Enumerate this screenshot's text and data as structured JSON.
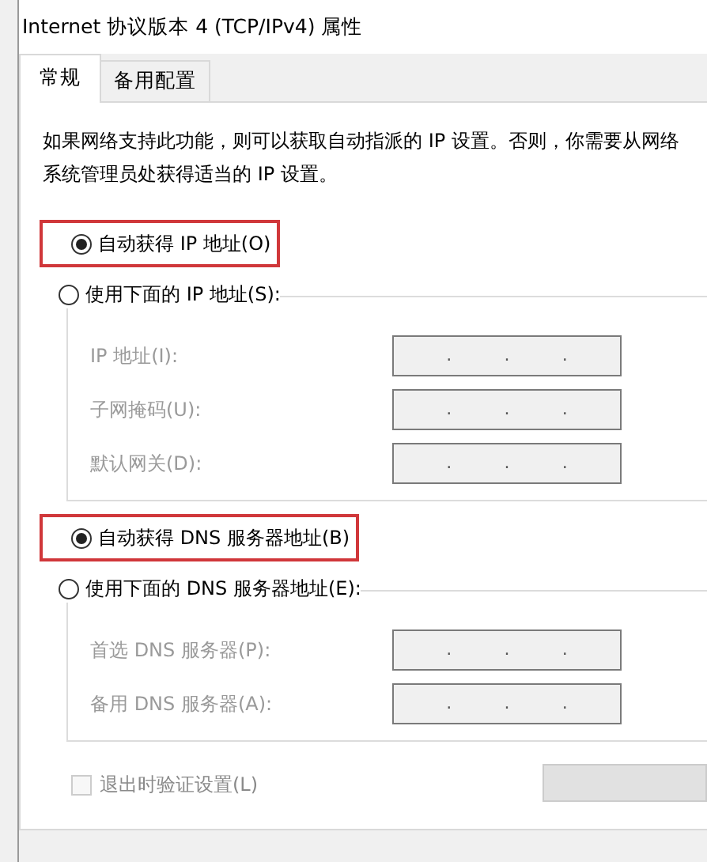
{
  "window": {
    "title": "Internet 协议版本 4 (TCP/IPv4) 属性"
  },
  "tabs": [
    {
      "label": "常规",
      "selected": true
    },
    {
      "label": "备用配置",
      "selected": false
    }
  ],
  "description": "如果网络支持此功能，则可以获取自动指派的 IP 设置。否则，你需要从网络系统管理员处获得适当的 IP 设置。",
  "sections": [
    {
      "auto_option": {
        "label": "自动获得 IP 地址(O)",
        "selected": true,
        "highlighted": true
      },
      "manual_option": {
        "label": "使用下面的 IP 地址(S):",
        "selected": false
      },
      "fields": [
        {
          "label": "IP 地址(I):",
          "disabled": true,
          "separators": [
            ".",
            ".",
            "."
          ]
        },
        {
          "label": "子网掩码(U):",
          "disabled": true,
          "separators": [
            ".",
            ".",
            "."
          ]
        },
        {
          "label": "默认网关(D):",
          "disabled": true,
          "separators": [
            ".",
            ".",
            "."
          ]
        }
      ]
    },
    {
      "auto_option": {
        "label": "自动获得 DNS 服务器地址(B)",
        "selected": true,
        "highlighted": true
      },
      "manual_option": {
        "label": "使用下面的 DNS 服务器地址(E):",
        "selected": false
      },
      "fields": [
        {
          "label": "首选 DNS 服务器(P):",
          "disabled": true,
          "separators": [
            ".",
            ".",
            "."
          ]
        },
        {
          "label": "备用 DNS 服务器(A):",
          "disabled": true,
          "separators": [
            ".",
            ".",
            "."
          ]
        }
      ]
    }
  ],
  "validate_checkbox": {
    "label": "退出时验证设置(L)",
    "checked": false,
    "disabled": true
  }
}
